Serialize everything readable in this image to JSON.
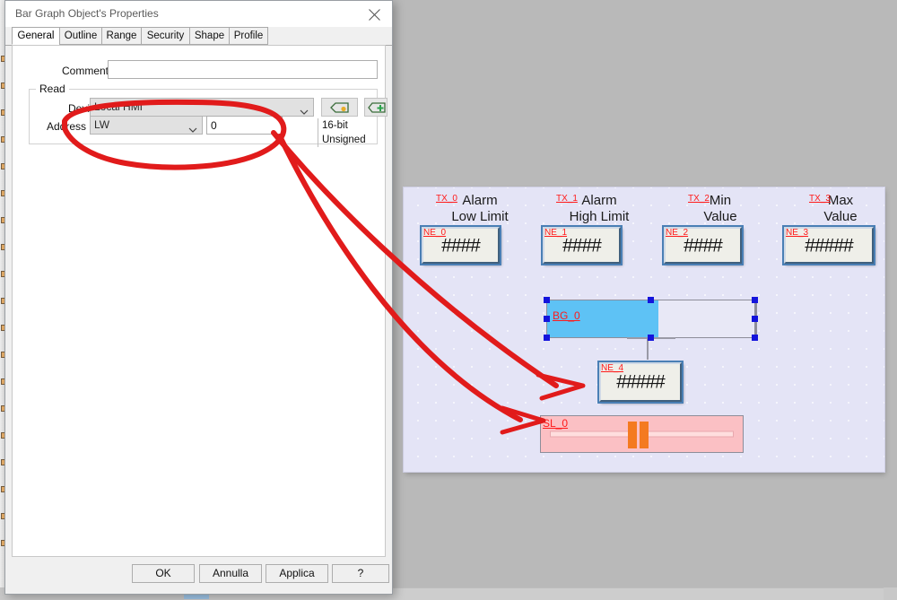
{
  "dialog": {
    "title": "Bar Graph Object's Properties",
    "close_icon": "close-icon",
    "tabs": [
      {
        "label": "General",
        "active": true
      },
      {
        "label": "Outline",
        "active": false
      },
      {
        "label": "Range",
        "active": false
      },
      {
        "label": "Security",
        "active": false
      },
      {
        "label": "Shape",
        "active": false
      },
      {
        "label": "Profile",
        "active": false
      }
    ],
    "comment_label": "Comment :",
    "comment_value": "",
    "comment_placeholder": "",
    "read_group_title": "Read",
    "device_label": "Device :",
    "device_value": "Local HMI",
    "address_label": "Address :",
    "address_type_value": "LW",
    "address_number_value": "0",
    "data_format": "16-bit Unsigned",
    "settings_icon": "settings-tag-icon",
    "add_icon": "add-tag-icon",
    "buttons": [
      {
        "label": "OK",
        "name": "ok-button"
      },
      {
        "label": "Annulla",
        "name": "cancel-button"
      },
      {
        "label": "Applica",
        "name": "apply-button"
      },
      {
        "label": "?",
        "name": "help-button"
      }
    ]
  },
  "canvas": {
    "columns": [
      {
        "tag": "TX_0",
        "caption_line1": "Alarm",
        "caption_line2": "Low Limit",
        "field_tag": "NE_0",
        "field_value": "####"
      },
      {
        "tag": "TX_1",
        "caption_line1": "Alarm",
        "caption_line2": "High Limit",
        "field_tag": "NE_1",
        "field_value": "####"
      },
      {
        "tag": "TX_2",
        "caption_line1": "Min",
        "caption_line2": "Value",
        "field_tag": "NE_2",
        "field_value": "####"
      },
      {
        "tag": "TX_3",
        "caption_line1": "Max",
        "caption_line2": "Value",
        "field_tag": "NE_3",
        "field_value": "#####"
      }
    ],
    "bargraph": {
      "tag": "BG_0",
      "fill_percent": 53,
      "selected": true
    },
    "numeric": {
      "tag": "NE_4",
      "value": "#####"
    },
    "slider": {
      "tag": "SL_0",
      "thumb_percent": 47
    }
  },
  "colors": {
    "annotation": "#e11b1b",
    "tag_text": "#ff1a1a",
    "bar_fill": "#5ec2f5",
    "selection_handle": "#1414dc",
    "slider_body": "#fbc0c4",
    "slider_thumb": "#f47a20",
    "canvas_bg": "#e4e4f6"
  }
}
